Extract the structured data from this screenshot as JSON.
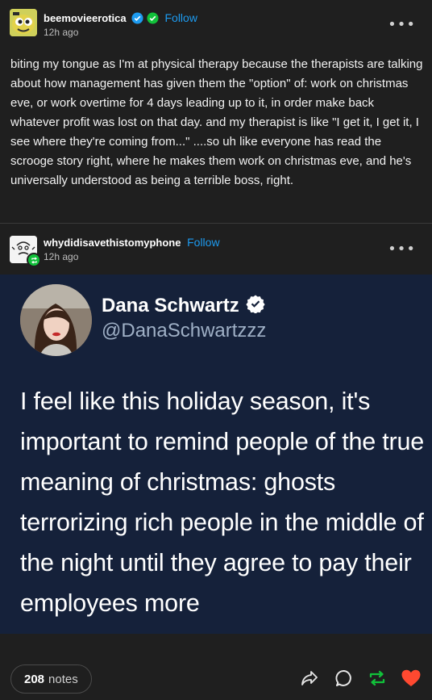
{
  "post": {
    "blog_name": "beemovieerotica",
    "follow_label": "Follow",
    "timestamp": "12h ago",
    "more_label": "•••",
    "body": "biting my tongue as I'm at physical therapy because the therapists are talking about how management has given them the \"option\" of: work on christmas eve, or work overtime for 4 days leading up to it, in order make back whatever profit was lost on that day.  and my therapist is like \"I get it, I get it, I see where they're coming from...\" ....so uh like everyone has read the scrooge story right, where he makes them work on christmas eve, and he's universally understood as being a terrible boss, right."
  },
  "reblog": {
    "blog_name": "whydidisavethistomyphone",
    "follow_label": "Follow",
    "timestamp": "12h ago",
    "more_label": "•••"
  },
  "tweet": {
    "name": "Dana Schwartz",
    "handle": "@DanaSchwartzzz",
    "text": "I feel like this holiday season, it's important to remind people of the true meaning of christmas: ghosts terrorizing rich people in the middle of the night until they agree to pay their employees more"
  },
  "footer": {
    "notes_count": "208",
    "notes_label": "notes",
    "actions": [
      "share-icon",
      "reply-icon",
      "reblog-icon",
      "like-icon"
    ]
  },
  "colors": {
    "background": "#1f1f1f",
    "follow": "#1d9bf0",
    "verified": "#1d9bf0",
    "reblog_green": "#11c13a",
    "like_red": "#ff4930",
    "tweet_bg": "#15213a"
  }
}
